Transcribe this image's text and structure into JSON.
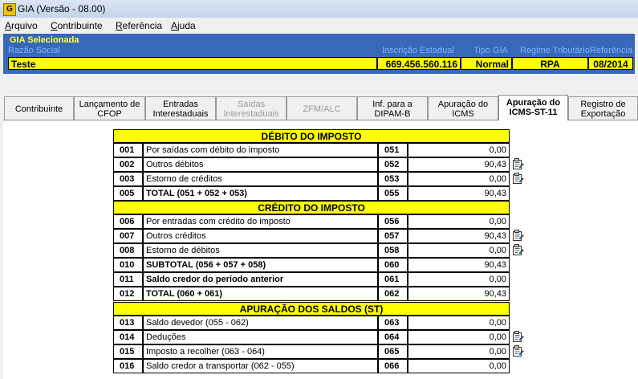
{
  "window": {
    "title": "GIA (Versão - 08.00)",
    "icon": "G"
  },
  "menu": [
    {
      "u": "A",
      "rest": "rquivo"
    },
    {
      "u": "C",
      "rest": "ontribuinte"
    },
    {
      "u": "R",
      "rest": "eferência"
    },
    {
      "u": "A",
      "rest": "juda"
    }
  ],
  "gia": {
    "heading": "GIA Selecionada",
    "labels": {
      "razao": "Razão Social",
      "ie": "Inscrição Estadual",
      "tipo": "Tipo GIA",
      "regime": "Regime Tributário",
      "ref": "Referência"
    },
    "values": {
      "razao": "Teste",
      "ie": "669.456.560.116",
      "tipo": "Normal",
      "regime": "RPA",
      "ref": "08/2014"
    }
  },
  "tabs": [
    {
      "l1": "Contribuinte",
      "l2": ""
    },
    {
      "l1": "Lançamento de",
      "l2": "CFOP"
    },
    {
      "l1": "Entradas",
      "l2": "Interestaduais"
    },
    {
      "l1": "Saídas",
      "l2": "Interestaduais"
    },
    {
      "l1": "ZFM/ALC",
      "l2": ""
    },
    {
      "l1": "Inf. para a",
      "l2": "DIPAM-B"
    },
    {
      "l1": "Apuração do",
      "l2": "ICMS"
    },
    {
      "l1": "Apuração do",
      "l2": "ICMS-ST-11"
    },
    {
      "l1": "Registro de",
      "l2": "Exportação"
    }
  ],
  "sections": {
    "debito": "DÉBITO DO IMPOSTO",
    "credito": "CRÉDITO DO IMPOSTO",
    "saldos": "APURAÇÃO DOS SALDOS (ST)"
  },
  "rows": [
    {
      "code": "001",
      "desc": "Por saídas com débito do imposto",
      "ref": "051",
      "value": "0,00"
    },
    {
      "code": "002",
      "desc": "Outros débitos",
      "ref": "052",
      "value": "90,43"
    },
    {
      "code": "003",
      "desc": "Estorno de créditos",
      "ref": "053",
      "value": "0,00"
    },
    {
      "code": "005",
      "desc": "TOTAL (051 + 052 + 053)",
      "ref": "055",
      "value": "90,43"
    },
    {
      "code": "006",
      "desc": "Por entradas com crédito do imposto",
      "ref": "056",
      "value": "0,00"
    },
    {
      "code": "007",
      "desc": "Outros créditos",
      "ref": "057",
      "value": "90,43"
    },
    {
      "code": "008",
      "desc": "Estorno de débitos",
      "ref": "058",
      "value": "0,00"
    },
    {
      "code": "010",
      "desc": "SUBTOTAL (056 + 057 + 058)",
      "ref": "060",
      "value": "90,43"
    },
    {
      "code": "011",
      "desc": "Saldo credor do período anterior",
      "ref": "061",
      "value": "0,00"
    },
    {
      "code": "012",
      "desc": "TOTAL (060 + 061)",
      "ref": "062",
      "value": "90,43"
    },
    {
      "code": "013",
      "desc": "Saldo devedor (055 - 062)",
      "ref": "063",
      "value": "0,00"
    },
    {
      "code": "014",
      "desc": "Deduções",
      "ref": "064",
      "value": "0,00"
    },
    {
      "code": "015",
      "desc": "Imposto a recolher (063 - 064)",
      "ref": "065",
      "value": "0,00"
    },
    {
      "code": "016",
      "desc": "Saldo credor a transportar (062 - 055)",
      "ref": "066",
      "value": "0,00"
    }
  ],
  "icons": {
    "edit": "edit-document-icon",
    "app": "gia-app-icon"
  },
  "colors": {
    "panel": "#3868b8",
    "highlight": "#ffff00",
    "label": "#7fb2ff"
  }
}
